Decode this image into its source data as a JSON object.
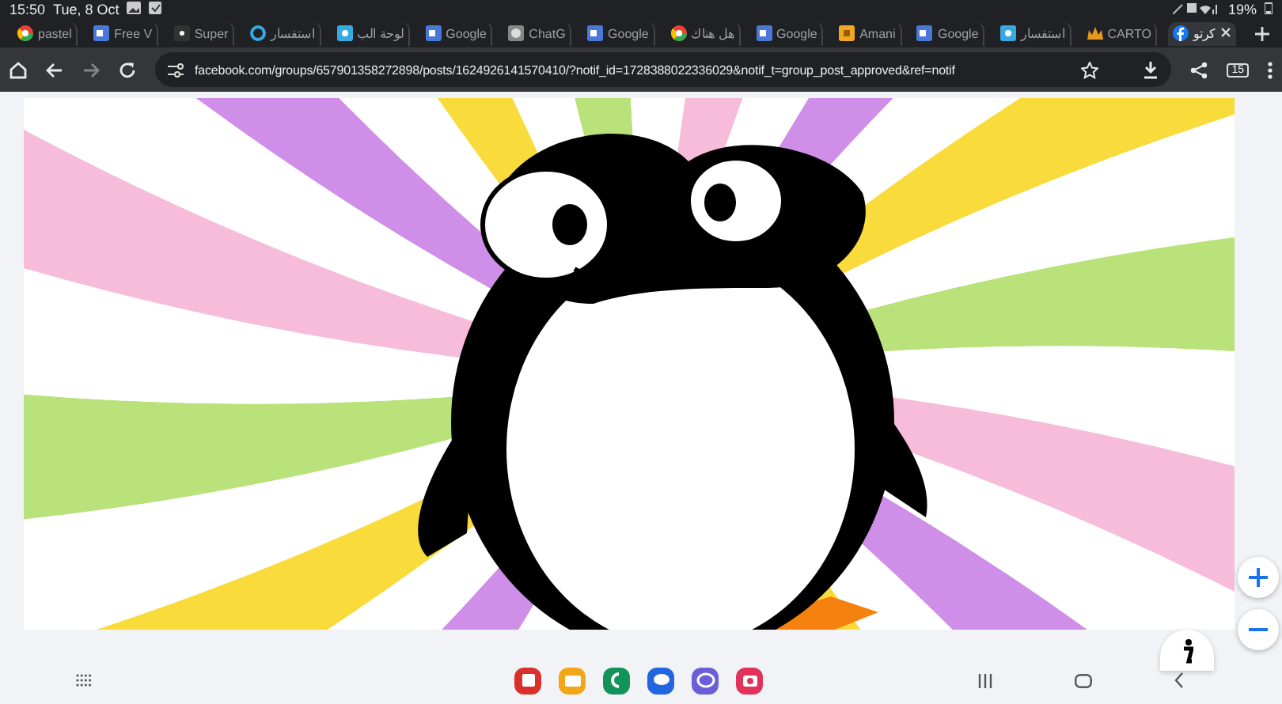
{
  "status_bar": {
    "time": "15:50",
    "date": "Tue, 8 Oct",
    "battery": "19%"
  },
  "tabs": [
    {
      "label": "pastel",
      "kind": "google",
      "selected": false
    },
    {
      "label": "Free V",
      "kind": "doc",
      "selected": false
    },
    {
      "label": "Super",
      "kind": "dark",
      "selected": false
    },
    {
      "label": "استفسار",
      "kind": "ring",
      "selected": false
    },
    {
      "label": "لوحة الب",
      "kind": "square",
      "selected": false
    },
    {
      "label": "Google",
      "kind": "doc",
      "selected": false
    },
    {
      "label": "ChatG",
      "kind": "grey",
      "selected": false
    },
    {
      "label": "Google",
      "kind": "doc",
      "selected": false
    },
    {
      "label": "هل هناك",
      "kind": "google",
      "selected": false
    },
    {
      "label": "Google",
      "kind": "doc",
      "selected": false
    },
    {
      "label": "Amani",
      "kind": "yellow",
      "selected": false
    },
    {
      "label": "Google",
      "kind": "doc",
      "selected": false
    },
    {
      "label": "استفسار",
      "kind": "square",
      "selected": false
    },
    {
      "label": "CARTO",
      "kind": "crown",
      "selected": false
    },
    {
      "label": "كرتو",
      "kind": "facebook",
      "selected": true
    }
  ],
  "toolbar": {
    "url": "facebook.com/groups/657901358272898/posts/1624926141570410/?notif_id=1728388022336029&notif_t=group_post_approved&ref=notif",
    "tab_count": "15"
  },
  "dock_apps": [
    {
      "color": "#d9302c"
    },
    {
      "color": "#f2a516"
    },
    {
      "color": "#12935a"
    },
    {
      "color": "#2166e0"
    },
    {
      "color": "#6a5fd8"
    },
    {
      "color": "#e0325a"
    }
  ]
}
